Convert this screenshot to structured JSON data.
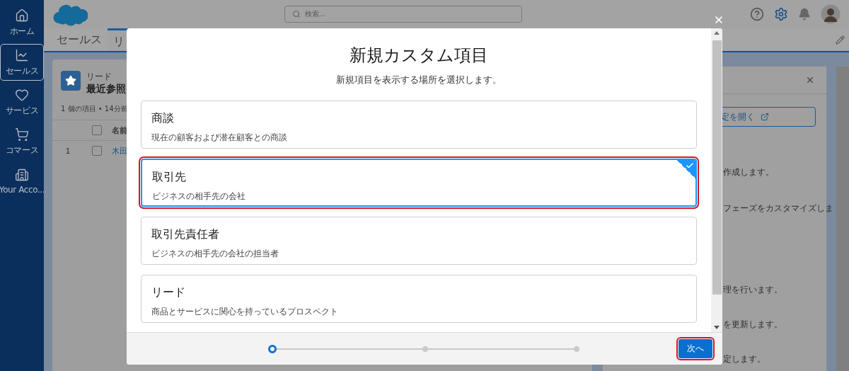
{
  "nav": [
    {
      "label": "ホーム",
      "selected": false
    },
    {
      "label": "セールス",
      "selected": true
    },
    {
      "label": "サービス",
      "selected": false
    },
    {
      "label": "コマース",
      "selected": false
    },
    {
      "label": "Your Acco...",
      "selected": false
    }
  ],
  "header": {
    "search_placeholder": "検索..."
  },
  "tabs": [
    {
      "label": "セールス",
      "selected": false
    },
    {
      "label": "リ",
      "selected": true
    }
  ],
  "list": {
    "object": "リード",
    "title": "最近参照",
    "meta": "1 個の項目 • 14分前",
    "columns": [
      "名前"
    ],
    "header_checked": false,
    "rows": [
      {
        "number": "1",
        "name": "木田",
        "checked": false
      }
    ]
  },
  "side_panel": {
    "button": "定を開く",
    "lines": [
      "作成します。",
      "フェーズをカスタマイズしま",
      "理を行います。",
      "を更新します。",
      "定します。"
    ]
  },
  "modal": {
    "title": "新規カスタム項目",
    "subtitle": "新規項目を表示する場所を選択します。",
    "options": [
      {
        "title": "商談",
        "description": "現在の顧客および潜在顧客との商談",
        "selected": false
      },
      {
        "title": "取引先",
        "description": "ビジネスの相手先の会社",
        "selected": true
      },
      {
        "title": "取引先責任者",
        "description": "ビジネスの相手先の会社の担当者",
        "selected": false
      },
      {
        "title": "リード",
        "description": "商品とサービスに関心を持っているプロスペクト",
        "selected": false
      }
    ],
    "steps": [
      {
        "selected": true
      },
      {
        "selected": false
      },
      {
        "selected": false
      }
    ],
    "next_button": {
      "label": "次へ",
      "highlighted": true
    }
  }
}
